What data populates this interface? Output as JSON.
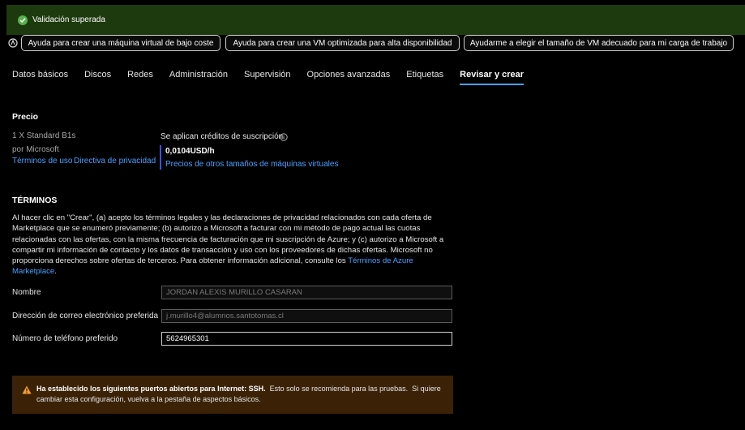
{
  "banner": {
    "text": "Validación superada"
  },
  "copilot": {
    "prompts": [
      "Ayuda para crear una máquina virtual de bajo coste",
      "Ayuda para crear una VM optimizada para alta disponibilidad",
      "Ayudarme a elegir el tamaño de VM adecuado para mi carga de trabajo"
    ]
  },
  "tabs": [
    "Datos básicos",
    "Discos",
    "Redes",
    "Administración",
    "Supervisión",
    "Opciones avanzadas",
    "Etiquetas",
    "Revisar y crear"
  ],
  "active_tab": "Revisar y crear",
  "price": {
    "heading": "Precio",
    "product": "1 X Standard B1s",
    "publisher": "por Microsoft",
    "terms_link": "Términos de uso",
    "privacy_link": "Directiva de privacidad",
    "credits_label": "Se aplican créditos de suscripción",
    "amount": "0,0104USD/h",
    "other_sizes_link": "Precios de otros tamaños de máquinas virtuales"
  },
  "terms": {
    "heading": "TÉRMINOS",
    "body": "Al hacer clic en \"Crear\", (a) acepto los términos legales y las declaraciones de privacidad relacionados con cada oferta de Marketplace que se enumeró previamente; (b) autorizo a Microsoft a facturar con mi método de pago actual las cuotas relacionadas con las ofertas, con la misma frecuencia de facturación que mi suscripción de Azure; y (c) autorizo a Microsoft a compartir mi información de contacto y los datos de transacción y uso con los proveedores de dichas ofertas. Microsoft no proporciona derechos sobre ofertas de terceros. Para obtener información adicional, consulte los ",
    "link": "Términos de Azure Marketplace",
    "suffix": "."
  },
  "form": {
    "name_label": "Nombre",
    "name_value": "JORDAN ALEXIS MURILLO CASARAN",
    "email_label": "Dirección de correo electrónico preferida",
    "email_value": "j.murillo4@alumnos.santotomas.cl",
    "phone_label": "Número de teléfono preferido",
    "phone_value": "5624965301"
  },
  "warning": {
    "bold": "Ha establecido los siguientes puertos abiertos para Internet: SSH.",
    "text": "  Esto solo se recomienda para las pruebas.  Si quiere cambiar esta configuración, vuelva a la pestaña de aspectos básicos."
  },
  "colors": {
    "banner_bg": "#1d3a0e",
    "link": "#4aa0ff",
    "warning_bg": "#3b2207",
    "active_tab_underline": "#4aa0ff"
  }
}
